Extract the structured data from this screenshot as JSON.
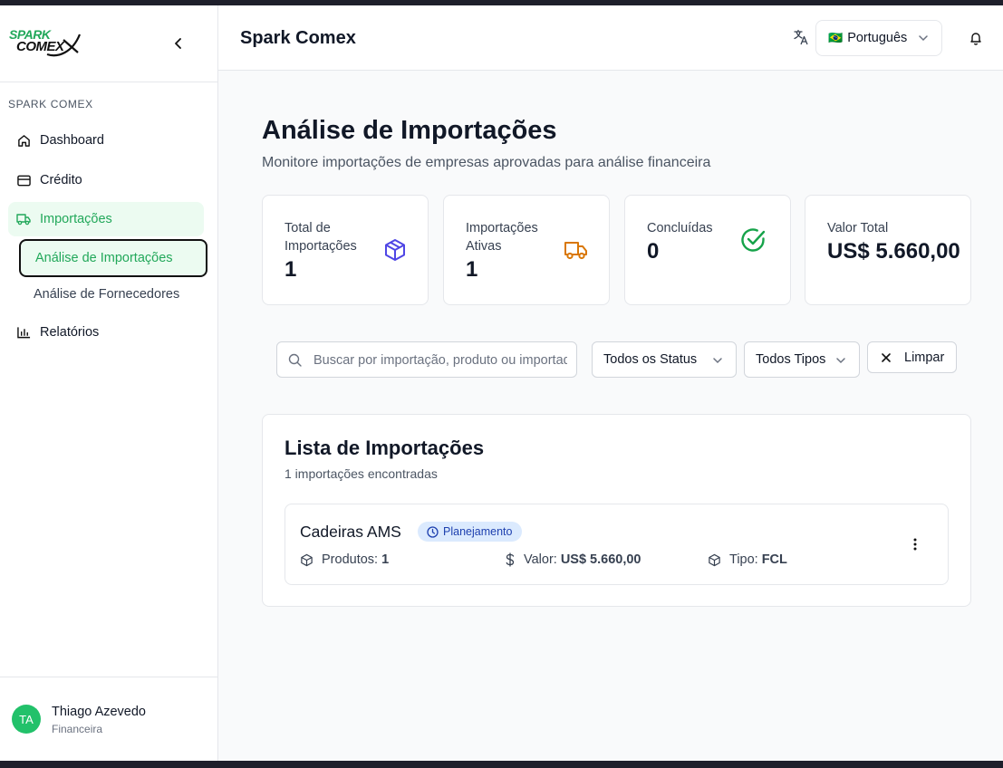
{
  "brand": {
    "logo_line1": "SPARK",
    "logo_line2": "COMEX"
  },
  "sidebar": {
    "section_label": "SPARK COMEX",
    "items": [
      {
        "label": "Dashboard",
        "icon": "home-icon"
      },
      {
        "label": "Crédito",
        "icon": "credit-card-icon"
      },
      {
        "label": "Importações",
        "icon": "truck-icon"
      },
      {
        "label": "Relatórios",
        "icon": "bar-chart-icon"
      }
    ],
    "subitems": [
      {
        "label": "Análise de Importações"
      },
      {
        "label": "Análise de Fornecedores"
      }
    ],
    "user": {
      "initials": "TA",
      "name": "Thiago Azevedo",
      "role": "Financeira"
    }
  },
  "header": {
    "title": "Spark Comex",
    "language": {
      "flag": "🇧🇷",
      "label": "Português"
    }
  },
  "page": {
    "title": "Análise de Importações",
    "subtitle": "Monitore importações de empresas aprovadas para análise financeira"
  },
  "stats": [
    {
      "label": "Total de Importações",
      "value": "1",
      "icon": "package-icon",
      "color": "#4f46e5"
    },
    {
      "label": "Importações Ativas",
      "value": "1",
      "icon": "truck-icon",
      "color": "#d97706"
    },
    {
      "label": "Concluídas",
      "value": "0",
      "icon": "check-circle-icon",
      "color": "#16a34a"
    },
    {
      "label": "Valor Total",
      "value": "US$ 5.660,00"
    }
  ],
  "filters": {
    "search_placeholder": "Buscar por importação, produto ou importador",
    "status_label": "Todos os Status",
    "type_label": "Todos Tipos",
    "clear_label": "Limpar"
  },
  "list": {
    "title": "Lista de Importações",
    "count_text": "1 importações encontradas",
    "items": [
      {
        "name": "Cadeiras AMS",
        "status": "Planejamento",
        "products_label": "Produtos:",
        "products_value": "1",
        "value_label": "Valor:",
        "value_value": "US$ 5.660,00",
        "type_label": "Tipo:",
        "type_value": "FCL"
      }
    ]
  },
  "colors": {
    "accent": "#22a85a",
    "active_bg": "#ecfbf1",
    "badge_bg": "#dbeafe",
    "badge_text": "#1e40af"
  }
}
